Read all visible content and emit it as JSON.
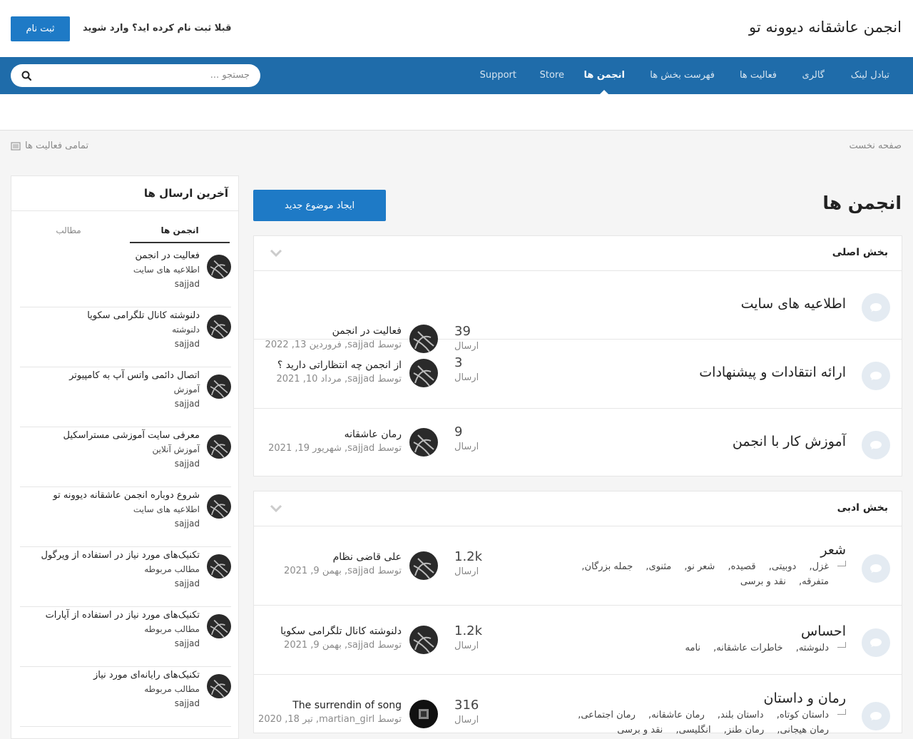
{
  "header": {
    "site_title": "انجمن عاشقانه دیوونه تو",
    "login_prompt": "قبلا ثبت نام کرده اید؟ وارد شوید",
    "register_label": "ثبت نام"
  },
  "nav": {
    "items": [
      {
        "label": "تبادل لینک"
      },
      {
        "label": "گالری"
      },
      {
        "label": "فعالیت ها"
      },
      {
        "label": "فهرست بخش ها"
      },
      {
        "label": "انجمن ها"
      },
      {
        "label": "Store"
      },
      {
        "label": "Support"
      }
    ],
    "active_index": 4,
    "search_placeholder": "جستجو ..."
  },
  "breadcrumb": {
    "home": "صفحه نخست",
    "all_activity": "تمامی فعالیت ها"
  },
  "main": {
    "page_title": "انجمن ها",
    "new_topic_label": "ایجاد موضوع جدید",
    "categories": [
      {
        "title": "بخش اصلی",
        "forums": [
          {
            "name": "اطلاعیه های سایت",
            "posts": "39",
            "posts_label": "ارسال",
            "last_title": "فعالیت در انجمن",
            "last_meta": "توسط sajjad, فروردین 13, 2022"
          },
          {
            "name": "ارائه انتقادات و پیشنهادات",
            "posts": "3",
            "posts_label": "ارسال",
            "last_title": "از انجمن چه انتظاراتی دارید ؟",
            "last_meta": "توسط sajjad, مرداد 10, 2021"
          },
          {
            "name": "آموزش کار با انجمن",
            "posts": "9",
            "posts_label": "ارسال",
            "last_title": "رمان عاشقانه",
            "last_meta": "توسط sajjad, شهریور 19, 2021"
          }
        ]
      },
      {
        "title": "بخش ادبی",
        "forums": [
          {
            "name": "شعر",
            "posts": "1.2k",
            "posts_label": "ارسال",
            "last_title": "علی قاضی نظام",
            "last_meta": "توسط sajjad, بهمن 9, 2021",
            "subforums_line1": [
              "غزل,",
              "دوبیتی,",
              "قصیده,",
              "شعر نو,",
              "مثنوی,",
              "جمله بزرگان,"
            ],
            "subforums_line2": [
              "متفرقه,",
              "نقد و برسی"
            ]
          },
          {
            "name": "احساس",
            "posts": "1.2k",
            "posts_label": "ارسال",
            "last_title": "دلنوشته کانال تلگرامی سکویا",
            "last_meta": "توسط sajjad, بهمن 9, 2021",
            "subforums_line1": [
              "دلنوشته,",
              "خاطرات عاشقانه,",
              "نامه"
            ]
          },
          {
            "name": "رمان و داستان",
            "posts": "316",
            "posts_label": "ارسال",
            "last_title": "The surrendin of song",
            "last_meta": "توسط martian_girl, تیر 18, 2020",
            "subforums_line1": [
              "داستان کوتاه,",
              "داستان بلند,",
              "رمان عاشقانه,",
              "رمان اجتماعی,"
            ],
            "subforums_line2": [
              "رمان هیجانی,",
              "رمان طنز,",
              "انگلیسی,",
              "نقد و برسی"
            ]
          }
        ]
      }
    ]
  },
  "sidebar": {
    "title": "آخرین ارسال ها",
    "tabs": [
      {
        "label": "انجمن ها"
      },
      {
        "label": "مطالب"
      }
    ],
    "items": [
      {
        "title": "فعالیت در انجمن",
        "forum": "اطلاعیه های سایت",
        "author": "sajjad"
      },
      {
        "title": "دلنوشته کانال تلگرامی سکویا",
        "forum": "دلنوشته",
        "author": "sajjad"
      },
      {
        "title": "اتصال دائمی واتس آپ به کامپیوتر",
        "forum": "آموزش",
        "author": "sajjad"
      },
      {
        "title": "معرفی سایت آموزشی مستراسکیل",
        "forum": "آموزش آنلاین",
        "author": "sajjad"
      },
      {
        "title": "شروع دوباره انجمن عاشقانه دیوونه تو",
        "forum": "اطلاعیه های سایت",
        "author": "sajjad"
      },
      {
        "title": "تکنیک‌های مورد نیاز در استفاده از ویرگول",
        "forum": "مطالب مربوطه",
        "author": "sajjad"
      },
      {
        "title": "تکنیک‌های مورد نیاز در استفاده از آپارات",
        "forum": "مطالب مربوطه",
        "author": "sajjad"
      },
      {
        "title": "تکنیک‌های رایانه‌ای مورد نیاز",
        "forum": "مطالب مربوطه",
        "author": "sajjad"
      }
    ]
  },
  "colors": {
    "brand": "#1f6caa",
    "button": "#1e7ac6",
    "forum_icon_bg": "#e4ebf2"
  }
}
